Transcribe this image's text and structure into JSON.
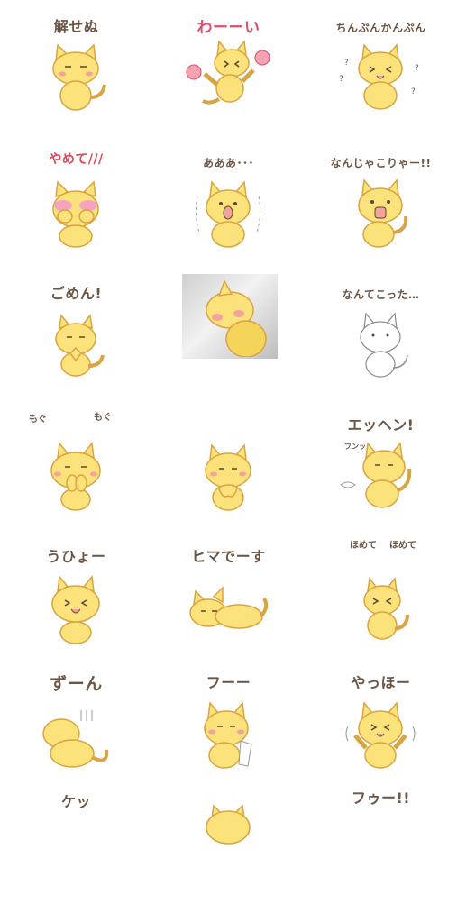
{
  "stickers": [
    {
      "label": "解せぬ"
    },
    {
      "label": "わーーい"
    },
    {
      "label": "ちんぷんかんぷん"
    },
    {
      "label": "やめて///"
    },
    {
      "label": "あああ･･･"
    },
    {
      "label": "なんじゃこりゃー!!"
    },
    {
      "label": "ごめん!"
    },
    {
      "label": ""
    },
    {
      "label": "なんてこった…"
    },
    {
      "label": "",
      "side_left": "もぐ",
      "side_right": "もぐ"
    },
    {
      "label": ""
    },
    {
      "label": "エッヘン!",
      "side_left": "フンッ"
    },
    {
      "label": "うひょー"
    },
    {
      "label": "ヒマでーす"
    },
    {
      "label": "",
      "side_left": "ほめて",
      "side_right": "ほめて"
    },
    {
      "label": "ずーん"
    },
    {
      "label": "フーー"
    },
    {
      "label": "やっほー"
    },
    {
      "label": "ケッ"
    },
    {
      "label": ""
    },
    {
      "label": "フゥー!!"
    }
  ],
  "colors": {
    "cat_fill": "#fbe27a",
    "cat_stroke": "#d9a441",
    "cheek": "#f4a39a",
    "text": "#6b5646",
    "pink": "#d9506b"
  }
}
